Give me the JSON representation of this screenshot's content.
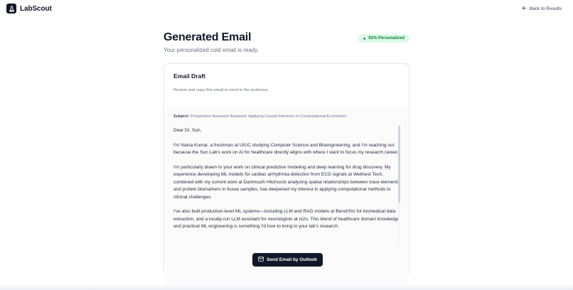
{
  "app": {
    "name": "LabScout",
    "back_label": "Back to Results"
  },
  "header": {
    "title": "Generated Email",
    "subtitle": "Your personalized cold email is ready.",
    "badge": "92% Personalized"
  },
  "card": {
    "title": "Email Draft",
    "description": "Review and copy this email to send to the professor"
  },
  "email": {
    "subject_label": "Subject:",
    "subject": "Prospective Research Assistant: Applying Causal Inference to Computational Economics",
    "greeting": "Dear Dr. Sun,",
    "paragraphs": [
      "I'm Naina Kumar, a freshman at UIUC studying Computer Science and Bioengineering, and I'm reaching out because the Sun Lab's work on AI for healthcare directly aligns with where I want to focus my research career.",
      "I'm particularly drawn to your work on clinical predictive modeling and deep learning for drug discovery. My experience developing ML models for cardiac arrhythmia detection from ECG signals at Wellnest Tech, combined with my current work at Dartmouth Hitchcock analyzing spatial relationships between trace elements and protein biomarkers in tissue samples, has deepened my interest in applying computational methods to clinical challenges.",
      "I've also built production-level ML systems—including LLM and RAG models at BenchSci for biomedical data extraction, and a locally-run LLM assistant for neurologists at ni2o. This blend of healthcare domain knowledge and practical ML engineering is something I'd love to bring to your lab's research."
    ],
    "scroll_position": 0
  },
  "actions": {
    "send_label": "Send Email by Outlook"
  },
  "colors": {
    "primary": "#111827",
    "badge_bg": "#dcfce7",
    "badge_text": "#15803d"
  }
}
